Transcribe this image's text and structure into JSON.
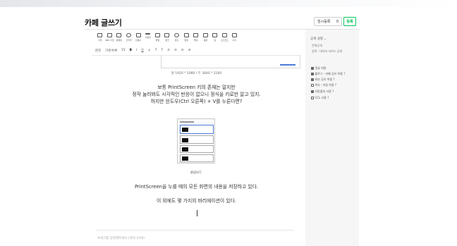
{
  "header": {
    "title": "카페 글쓰기",
    "temp_save_label": "임시등록",
    "temp_save_count": "0",
    "register_label": "등록"
  },
  "toolbar": {
    "tools": [
      "사진",
      "SNS 사진",
      "동영상",
      "스티커",
      "인용구",
      "구분선",
      "파일",
      "링크",
      "장소",
      "일정",
      "투표",
      "설문",
      "표",
      "소스코드",
      "수식"
    ],
    "format": {
      "paragraph": "본문",
      "font": "기본서체",
      "size": "15",
      "bold": "B",
      "italic": "I",
      "underline": "U",
      "strike": "ㅊ",
      "color": "T",
      "bg": "T",
      "align": "≡",
      "lineheight": "≡",
      "list": "≡",
      "link": "⊘"
    }
  },
  "content": {
    "image_size_caption": "원 1920 * 1080 / 두 3840 * 2160",
    "para1": "보통 PrintScreen 키의 존재는 알지만",
    "para2": "정작 눌러봐도 시각적인 반응이 없으니 정식을 키로만 알고 있지.",
    "para3": "하지만 윈도우(Ctrl 오른쪽) + V를 누른다면?",
    "clipboard_caption": "클립보드",
    "para4": "PrintScreen을 누를 때의 모든 화면의 내용을 저장하고 있다.",
    "para5": "이 외에도 몇 가지의 바리에이션이 있다.",
    "tag_placeholder": "#태그를 입력해주세요 (최대 10개)"
  },
  "sidebar": {
    "section_title": "공개 설정 ⌄",
    "visibility_options": [
      "전체공개",
      "검색 · 네이버 서비스 공개"
    ],
    "checkboxes": [
      {
        "label": "댓글 허용",
        "checked": true
      },
      {
        "label": "블로그 · 카페 공유 허용 ?",
        "checked": true
      },
      {
        "label": "외부 공유 허용 ?",
        "checked": true
      },
      {
        "label": "복사 · 저장 허용 ?",
        "checked": false
      },
      {
        "label": "자동출처 사용 ?",
        "checked": true
      },
      {
        "label": "CCL 사용 ?",
        "checked": false
      }
    ]
  }
}
